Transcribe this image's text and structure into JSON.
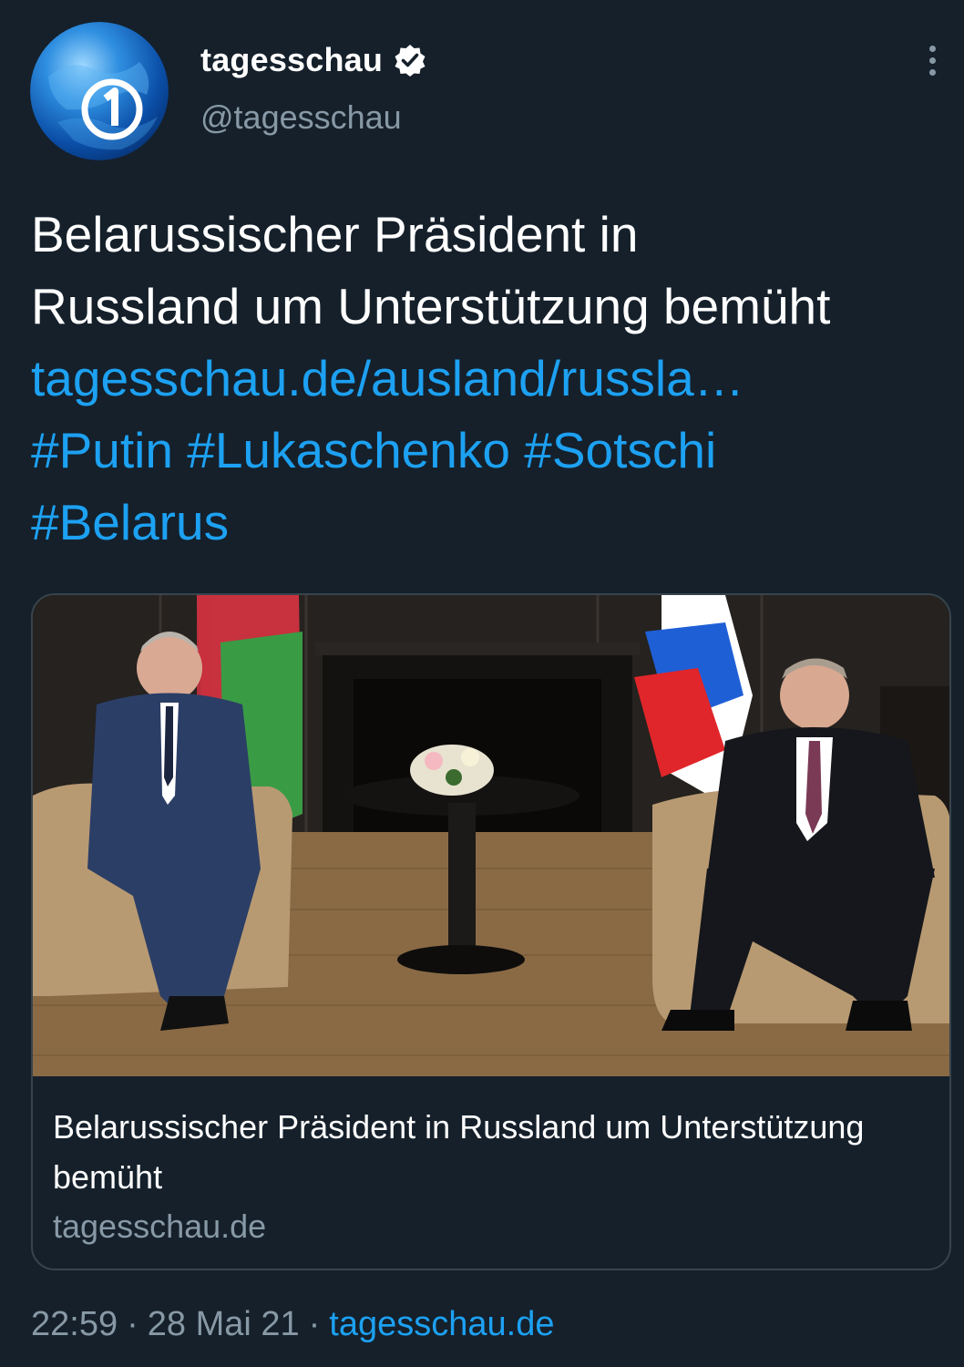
{
  "author": {
    "name": "tagesschau",
    "handle": "@tagesschau",
    "verified": true,
    "avatar_icon": "tagesschau-logo-icon"
  },
  "tweet": {
    "text_lines": [
      "Belarussischer Präsident in",
      "Russland um Unterstützung bemüht"
    ],
    "link": "tagesschau.de/ausland/russla…",
    "hashtags": [
      "#Putin",
      "#Lukaschenko",
      "#Sotschi",
      "#Belarus"
    ]
  },
  "card": {
    "title": "Belarussischer Präsident in Russland um Unterstützung bemüht",
    "domain": "tagesschau.de",
    "image_icon": "news-photo"
  },
  "meta": {
    "time": "22:59",
    "date": "28 Mai 21",
    "separator": "·",
    "source": "tagesschau.de"
  },
  "colors": {
    "background": "#15202b",
    "text": "#ffffff",
    "secondary": "#8899a6",
    "link": "#1da1f2",
    "border": "#38444d"
  }
}
